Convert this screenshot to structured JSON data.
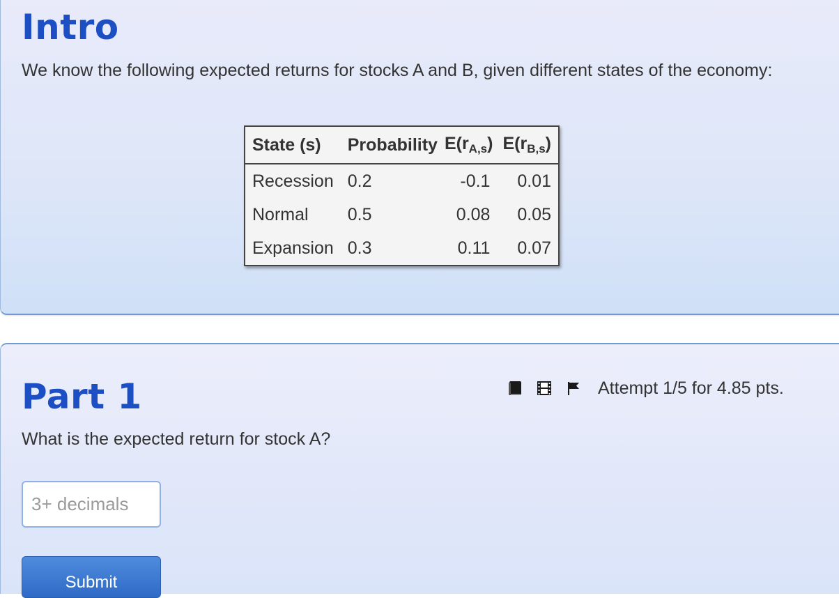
{
  "intro": {
    "title": "Intro",
    "text": "We know the following expected returns for stocks A and B, given different states of the economy:"
  },
  "table": {
    "headers": {
      "state": "State (s)",
      "probability": "Probability",
      "era_prefix": "E(r",
      "era_sub": "A,s",
      "era_suffix": ")",
      "erb_prefix": "E(r",
      "erb_sub": "B,s",
      "erb_suffix": ")"
    },
    "rows": [
      {
        "state": "Recession",
        "probability": "0.2",
        "era": "-0.1",
        "erb": "0.01"
      },
      {
        "state": "Normal",
        "probability": "0.5",
        "era": "0.08",
        "erb": "0.05"
      },
      {
        "state": "Expansion",
        "probability": "0.3",
        "era": "0.11",
        "erb": "0.07"
      }
    ]
  },
  "part": {
    "title": "Part 1",
    "question": "What is the expected return for stock A?",
    "attempt": "Attempt 1/5 for 4.85 pts.",
    "input_placeholder": "3+ decimals",
    "submit_label": "Submit",
    "icons": [
      "book-icon",
      "film-icon",
      "flag-icon"
    ]
  },
  "colors": {
    "heading": "#1d4fc4",
    "button": "#2f6bc6",
    "card_border": "#6f9ad4"
  }
}
